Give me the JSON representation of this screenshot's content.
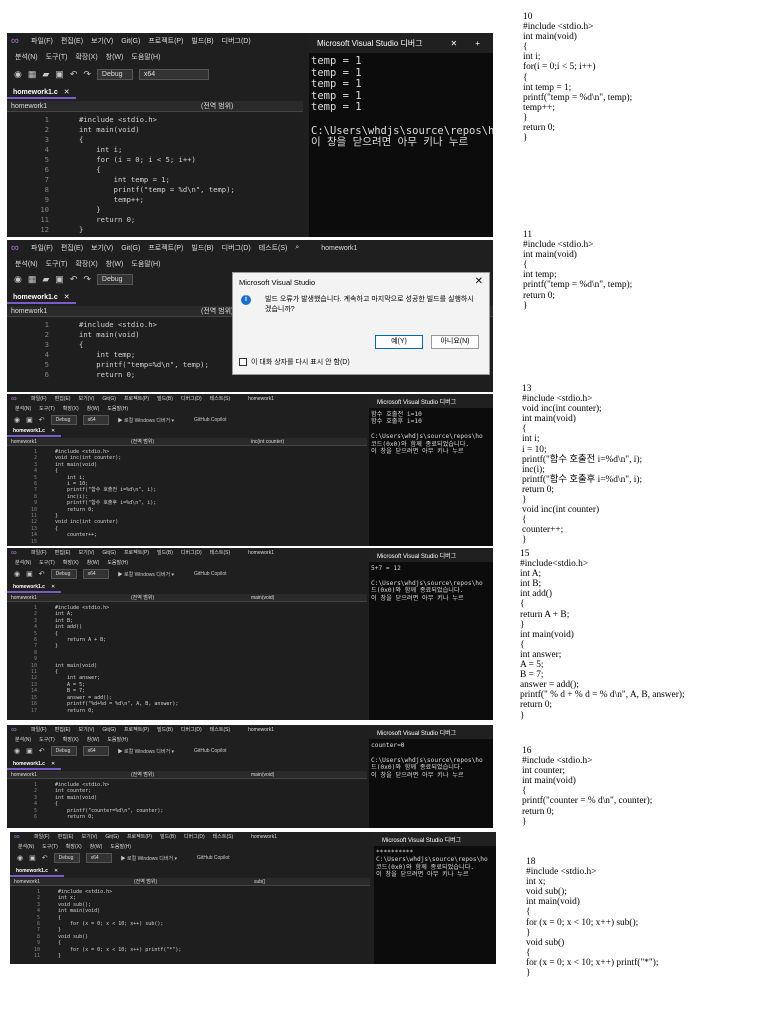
{
  "menu1": {
    "items": [
      "파일(F)",
      "편집(E)",
      "보기(V)",
      "Git(G)",
      "프로젝트(P)",
      "빌드(B)",
      "디버그(D)"
    ],
    "items2": [
      "분석(N)",
      "도구(T)",
      "확장(X)",
      "창(W)",
      "도움말(H)"
    ]
  },
  "menu2": {
    "items": [
      "파일(F)",
      "편집(E)",
      "보기(V)",
      "Git(G)",
      "프로젝트(P)",
      "빌드(B)",
      "디버그(D)",
      "테스트(S)"
    ],
    "items2": [
      "분석(N)",
      "도구(T)",
      "확장(X)",
      "창(W)",
      "도움말(H)"
    ],
    "title": "homework1"
  },
  "menu_small": {
    "items": [
      "파일(F)",
      "편집(E)",
      "보기(V)",
      "Git(G)",
      "프로젝트(P)",
      "빌드(B)",
      "디버그(D)",
      "테스트(S)"
    ],
    "items2": [
      "분석(N)",
      "도구(T)",
      "확장(X)",
      "창(W)",
      "도움말(H)"
    ],
    "title": "homework1",
    "run": "▶ 로컬 Windows 디버거 ▾",
    "copilot": "GitHub Copilot"
  },
  "toolbar": {
    "config": "Debug",
    "platform": "x64"
  },
  "file_tab": "homework1.c",
  "project": "homework1",
  "scope": "(전역 범위)",
  "console": {
    "title": "Microsoft Visual Studio 디버그",
    "s1": "temp = 1\ntemp = 1\ntemp = 1\ntemp = 1\ntemp = 1\n\nC:\\Users\\whdjs\\source\\repos\\ho\n이 창을 닫으려면 아무 키나 누르",
    "s3": "함수 호출전 i=10\n함수 호출후 i=10\n\nC:\\Users\\whdjs\\source\\repos\\ho\n코드(0x0)와 함께 종료되었습니다.\n이 창을 닫으려면 아무 키나 누르",
    "s4": "5+7 = 12\n\nC:\\Users\\whdjs\\source\\repos\\ho\n드(0x0)와 함께 종료되었습니다.\n이 창을 닫으려면 아무 키나 누르",
    "s5": "counter=0\n\nC:\\Users\\whdjs\\source\\repos\\ho\n드(0x0)와 함께 종료되었습니다.\n이 창을 닫으려면 아무 키나 누르",
    "s6": "**********\nC:\\Users\\whdjs\\source\\repos\\ho\n코드(0x0)와 함께 종료되었습니다.\n이 창을 닫으려면 아무 키나 누르"
  },
  "code": {
    "s1": "#include <stdio.h>\nint main(void)\n{\n    int i;\n    for (i = 0; i < 5; i++)\n    {\n        int temp = 1;\n        printf(\"temp = %d\\n\", temp);\n        temp++;\n    }\n    return 0;\n}",
    "s1_lines": "1\n2\n3\n4\n5\n6\n7\n8\n9\n10\n11\n12",
    "s2": "#include <stdio.h>\nint main(void)\n{\n    int temp;\n    printf(\"temp=%d\\n\", temp);\n    return 0;",
    "s2_lines": "1\n2\n3\n4\n5\n6",
    "s3": "#include <stdio.h>\nvoid inc(int counter);\nint main(void)\n{\n    int i;\n    i = 10;\n    printf(\"함수 호출전 i=%d\\n\", i);\n    inc(i);\n    printf(\"함수 호출후 i=%d\\n\", i);\n    return 0;\n}\nvoid inc(int counter)\n{\n    counter++;",
    "s3_lines": "1\n2\n3\n4\n5\n6\n7\n8\n9\n10\n11\n12\n13\n14\n15",
    "s4": "#include <stdio.h>\nint A;\nint B;\nint add()\n{\n    return A + B;\n}\n\n\nint main(void)\n{\n    int answer;\n    A = 5;\n    B = 7;\n    answer = add();\n    printf(\"%d+%d = %d\\n\", A, B, answer);\n    return 0;",
    "s4_lines": "1\n2\n3\n4\n5\n6\n7\n8\n9\n10\n11\n12\n13\n14\n15\n16\n17",
    "s5": "#include <stdio.h>\nint counter;\nint main(void)\n{\n    printf(\"counter=%d\\n\", counter);\n    return 0;",
    "s5_lines": "1\n2\n3\n4\n5\n6",
    "s6": "#include <stdio.h>\nint x;\nvoid sub();\nint main(void)\n{\n    for (x = 0; x < 10; x++) sub();\n}\nvoid sub()\n{\n    for (x = 0; x < 10; x++) printf(\"*\");\n}",
    "s6_lines": "1\n2\n3\n4\n5\n6\n7\n8\n9\n10\n11"
  },
  "scopes": {
    "s3": "inc(int counter)",
    "s4": "main(void)",
    "s5": "main(void)",
    "s6": "sub()"
  },
  "dialog": {
    "title": "Microsoft Visual Studio",
    "message": "빌드 오류가 발생했습니다. 계속하고 마지막으로 성공한 빌드를 실행하시겠습니까?",
    "yes": "예(Y)",
    "no": "아니요(N)",
    "checkbox": "이 대화 상자를 다시 표시 안 함(D)"
  },
  "notes": {
    "n10": "10\n#include <stdio.h>\nint main(void)\n{\nint i;\nfor(i = 0;i < 5; i++)\n{\nint temp = 1;\nprintf(\"temp = %d\\n\", temp);\ntemp++;\n}\nreturn 0;\n}",
    "n11": "11\n#include <stdio.h>\nint main(void)\n{\nint temp;\nprintf(\"temp = %d\\n\", temp);\nreturn 0;\n}",
    "n13": "13\n#include <stdio.h>\nvoid inc(int counter);\nint main(void)\n{\nint i;\ni = 10;\nprintf(\"함수 호출전 i=%d\\n\", i);\ninc(i);\nprintf(\"함수 호출후 i=%d\\n\", i);\nreturn 0;\n}\nvoid inc(int counter)\n{\ncounter++;\n}",
    "n15": "15\n#include<stdio.h>\nint A;\nint B;\nint add()\n{\nreturn A + B;\n}\nint main(void)\n{\nint answer;\nA = 5;\nB = 7;\nanswer = add();\nprintf(\" % d + % d = % d\\n\", A, B, answer);\nreturn 0;\n}",
    "n16": "16\n#include <stdio.h>\nint counter;\nint main(void)\n{\nprintf(\"counter = % d\\n\", counter);\nreturn 0;\n}",
    "n18": "18\n#include <stdio.h>\nint x;\nvoid sub();\nint main(void)\n{\nfor (x = 0; x < 10; x++) sub();\n}\nvoid sub()\n{\nfor (x = 0; x < 10; x++) printf(\"*\");\n}"
  }
}
